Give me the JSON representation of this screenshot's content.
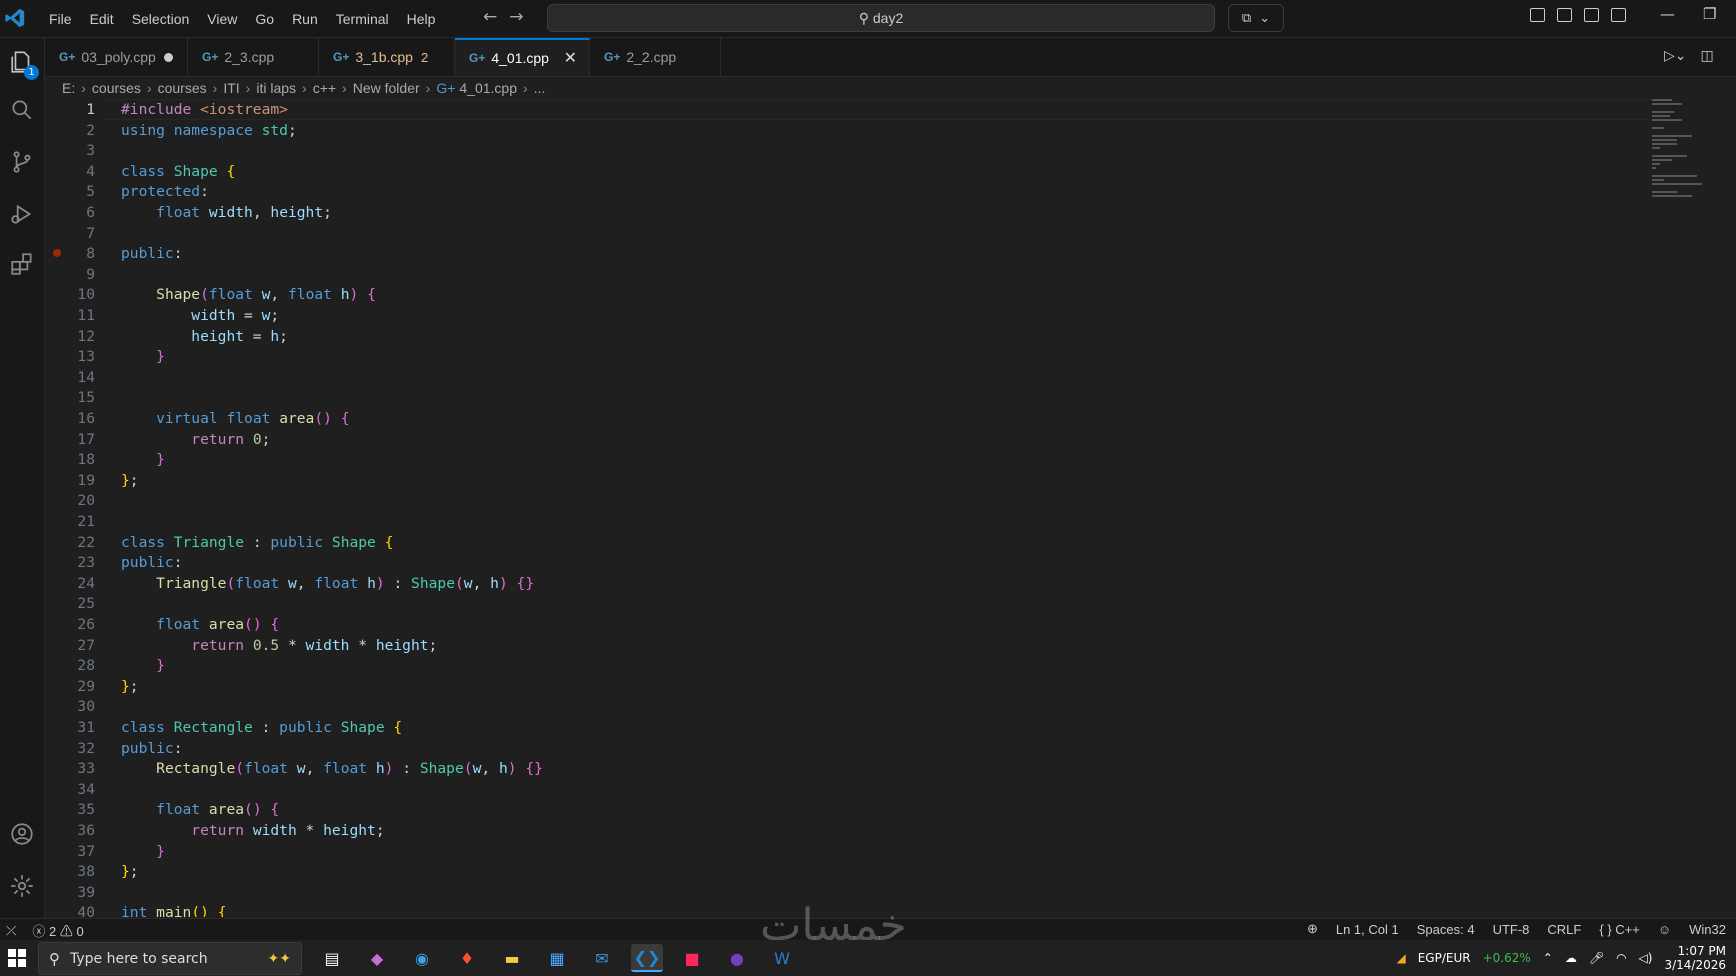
{
  "titlebar": {
    "menu": [
      "File",
      "Edit",
      "Selection",
      "View",
      "Go",
      "Run",
      "Terminal",
      "Help"
    ],
    "command_center": "day2",
    "colors": {
      "accent": "#0078d4",
      "bg": "#181818",
      "editor": "#1f1f1f"
    }
  },
  "activity_bar": {
    "explorer_badge": "1",
    "icons": [
      "explorer-icon",
      "search-icon",
      "source-control-icon",
      "run-debug-icon",
      "extensions-icon",
      "account-icon",
      "settings-icon"
    ]
  },
  "tabs": [
    {
      "label": "03_poly.cpp",
      "modified": true
    },
    {
      "label": "2_3.cpp"
    },
    {
      "label": "3_1b.cpp",
      "problems": "2"
    },
    {
      "label": "4_01.cpp",
      "active": true
    },
    {
      "label": "2_2.cpp"
    }
  ],
  "breadcrumb": [
    "E:",
    "courses",
    "courses",
    "ITI",
    "iti laps",
    "c++",
    "New folder",
    "4_01.cpp",
    "..."
  ],
  "editor": {
    "active_line": 1,
    "breakpoint_line": 8,
    "lines": [
      {
        "n": "1",
        "html": "<span class='pp'>#include</span> <span class='st'>&lt;iostream&gt;</span>"
      },
      {
        "n": "2",
        "html": "<span class='kw'>using</span> <span class='kw'>namespace</span> <span class='ty'>std</span>;"
      },
      {
        "n": "3",
        "html": ""
      },
      {
        "n": "4",
        "html": "<span class='kw'>class</span> <span class='ty'>Shape</span> <span class='br1'>{</span>"
      },
      {
        "n": "5",
        "html": "<span class='kw'>protected</span>:"
      },
      {
        "n": "6",
        "html": "    <span class='kw'>float</span> <span class='va'>width</span>, <span class='va'>height</span>;"
      },
      {
        "n": "7",
        "html": ""
      },
      {
        "n": "8",
        "html": "<span class='kw'>public</span>:"
      },
      {
        "n": "9",
        "html": ""
      },
      {
        "n": "10",
        "html": "    <span class='fn'>Shape</span><span class='br2'>(</span><span class='kw'>float</span> <span class='va'>w</span>, <span class='kw'>float</span> <span class='va'>h</span><span class='br2'>)</span> <span class='br2'>{</span>"
      },
      {
        "n": "11",
        "html": "        <span class='va'>width</span> = <span class='va'>w</span>;"
      },
      {
        "n": "12",
        "html": "        <span class='va'>height</span> = <span class='va'>h</span>;"
      },
      {
        "n": "13",
        "html": "    <span class='br2'>}</span>"
      },
      {
        "n": "14",
        "html": ""
      },
      {
        "n": "15",
        "html": ""
      },
      {
        "n": "16",
        "html": "    <span class='kw'>virtual</span> <span class='kw'>float</span> <span class='fn'>area</span><span class='br2'>()</span> <span class='br2'>{</span>"
      },
      {
        "n": "17",
        "html": "        <span class='pp'>return</span> <span class='nu'>0</span>;"
      },
      {
        "n": "18",
        "html": "    <span class='br2'>}</span>"
      },
      {
        "n": "19",
        "html": "<span class='br1'>}</span>;"
      },
      {
        "n": "20",
        "html": ""
      },
      {
        "n": "21",
        "html": ""
      },
      {
        "n": "22",
        "html": "<span class='kw'>class</span> <span class='ty'>Triangle</span> : <span class='kw'>public</span> <span class='ty'>Shape</span> <span class='br1'>{</span>"
      },
      {
        "n": "23",
        "html": "<span class='kw'>public</span>:"
      },
      {
        "n": "24",
        "html": "    <span class='fn'>Triangle</span><span class='br2'>(</span><span class='kw'>float</span> <span class='va'>w</span>, <span class='kw'>float</span> <span class='va'>h</span><span class='br2'>)</span> : <span class='ty'>Shape</span><span class='br2'>(</span><span class='va'>w</span>, <span class='va'>h</span><span class='br2'>)</span> <span class='br2'>{}</span>"
      },
      {
        "n": "25",
        "html": ""
      },
      {
        "n": "26",
        "html": "    <span class='kw'>float</span> <span class='fn'>area</span><span class='br2'>()</span> <span class='br2'>{</span>"
      },
      {
        "n": "27",
        "html": "        <span class='pp'>return</span> <span class='nu'>0.5</span> * <span class='va'>width</span> * <span class='va'>height</span>;"
      },
      {
        "n": "28",
        "html": "    <span class='br2'>}</span>"
      },
      {
        "n": "29",
        "html": "<span class='br1'>}</span>;"
      },
      {
        "n": "30",
        "html": ""
      },
      {
        "n": "31",
        "html": "<span class='kw'>class</span> <span class='ty'>Rectangle</span> : <span class='kw'>public</span> <span class='ty'>Shape</span> <span class='br1'>{</span>"
      },
      {
        "n": "32",
        "html": "<span class='kw'>public</span>:"
      },
      {
        "n": "33",
        "html": "    <span class='fn'>Rectangle</span><span class='br2'>(</span><span class='kw'>float</span> <span class='va'>w</span>, <span class='kw'>float</span> <span class='va'>h</span><span class='br2'>)</span> : <span class='ty'>Shape</span><span class='br2'>(</span><span class='va'>w</span>, <span class='va'>h</span><span class='br2'>)</span> <span class='br2'>{}</span>"
      },
      {
        "n": "34",
        "html": ""
      },
      {
        "n": "35",
        "html": "    <span class='kw'>float</span> <span class='fn'>area</span><span class='br2'>()</span> <span class='br2'>{</span>"
      },
      {
        "n": "36",
        "html": "        <span class='pp'>return</span> <span class='va'>width</span> * <span class='va'>height</span>;"
      },
      {
        "n": "37",
        "html": "    <span class='br2'>}</span>"
      },
      {
        "n": "38",
        "html": "<span class='br1'>}</span>;"
      },
      {
        "n": "39",
        "html": ""
      },
      {
        "n": "40",
        "html": "<span class='kw'>int</span> <span class='fn'>main</span><span class='br1'>()</span> <span class='br1'>{</span>"
      }
    ]
  },
  "statusbar": {
    "errors": "2",
    "warnings": "0",
    "position": "Ln 1, Col 1",
    "spaces": "Spaces: 4",
    "encoding": "UTF-8",
    "eol": "CRLF",
    "language": "C++",
    "platform": "Win32"
  },
  "taskbar": {
    "search_placeholder": "Type here to search",
    "ticker_pair": "EGP/EUR",
    "ticker_change": "+0.62%",
    "time": "1:07 PM",
    "date": "3/14/2026",
    "ticker_color": "#3fb950"
  },
  "watermark": "خمسات"
}
